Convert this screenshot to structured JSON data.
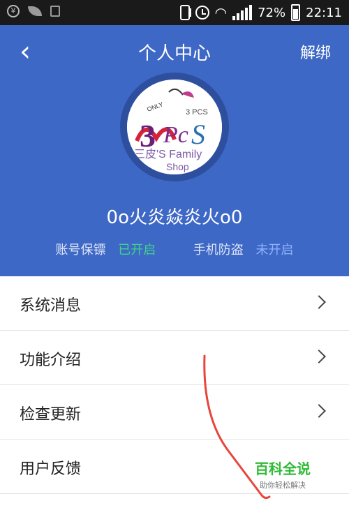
{
  "status_bar": {
    "battery": "72%",
    "time": "22:11"
  },
  "header": {
    "title": "个人中心",
    "action": "解绑",
    "avatar_text": {
      "logo": "3pcs",
      "top": "3 PCS",
      "name": "三皮'S Family",
      "shop": "Shop"
    },
    "nickname": "0o火炎焱炎火o0",
    "status": [
      {
        "label": "账号保镖",
        "value": "已开启"
      },
      {
        "label": "手机防盗",
        "value": "未开启"
      }
    ]
  },
  "menu": [
    {
      "label": "系统消息"
    },
    {
      "label": "功能介绍"
    },
    {
      "label": "检查更新"
    },
    {
      "label": "用户反馈"
    }
  ],
  "watermark": {
    "main": "百科全说",
    "sub": "助你轻松解决"
  },
  "colors": {
    "header_bg": "#3e68c6",
    "enabled": "#3fd48a",
    "disabled": "#8fb3ff"
  }
}
